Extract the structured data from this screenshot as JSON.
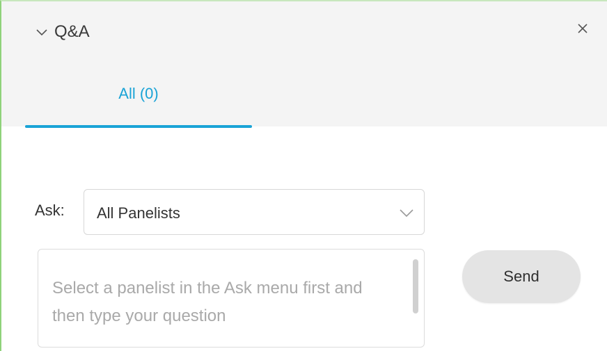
{
  "panel": {
    "title": "Q&A",
    "collapse_icon": "chevron-down-icon",
    "close_icon": "close-icon"
  },
  "tabs": [
    {
      "label": "All (0)",
      "active": true
    }
  ],
  "ask": {
    "label": "Ask:",
    "selected": "All Panelists",
    "dropdown_icon": "chevron-down-icon"
  },
  "question": {
    "placeholder": "Select a panelist in the Ask menu first and then type your question",
    "value": ""
  },
  "send_button": {
    "label": "Send"
  },
  "colors": {
    "accent": "#1aa3d6",
    "header_bg": "#f4f4f4",
    "button_bg": "#e4e4e4",
    "placeholder": "#a9a9a9"
  }
}
